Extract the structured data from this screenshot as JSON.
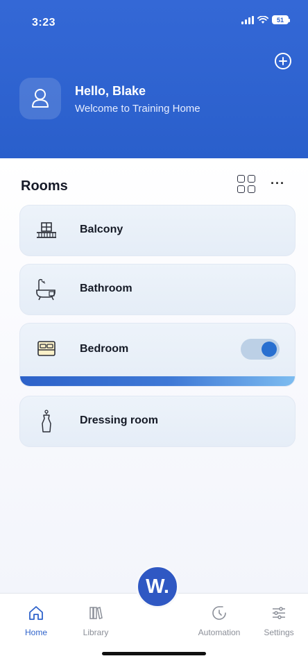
{
  "status_bar": {
    "time": "3:23",
    "battery": "51"
  },
  "header": {
    "greeting": "Hello, Blake",
    "welcome": "Welcome to Training Home",
    "add_icon": "plus-circle-icon",
    "avatar_icon": "user-icon"
  },
  "rooms": {
    "title": "Rooms",
    "grid_icon": "grid-view-icon",
    "more_label": "···",
    "items": [
      {
        "label": "Balcony",
        "icon": "balcony-icon"
      },
      {
        "label": "Bathroom",
        "icon": "bathtub-icon"
      },
      {
        "label": "Bedroom",
        "icon": "bed-icon",
        "toggle_on": true,
        "progress": 1.0
      },
      {
        "label": "Dressing room",
        "icon": "dress-icon"
      }
    ]
  },
  "tabbar": {
    "home": {
      "label": "Home",
      "icon": "home-icon",
      "active": true
    },
    "library": {
      "label": "Library",
      "icon": "library-icon"
    },
    "center": {
      "label": "W.",
      "icon": "w-logo-icon"
    },
    "automation": {
      "label": "Automation",
      "icon": "automation-icon"
    },
    "settings": {
      "label": "Settings",
      "icon": "settings-sliders-icon"
    }
  },
  "colors": {
    "header_blue": "#2a5fcb",
    "card_bg": "#e8eff8",
    "accent": "#286fd0",
    "tab_active": "#2f63cb",
    "tab_inactive": "#8b8f98"
  }
}
